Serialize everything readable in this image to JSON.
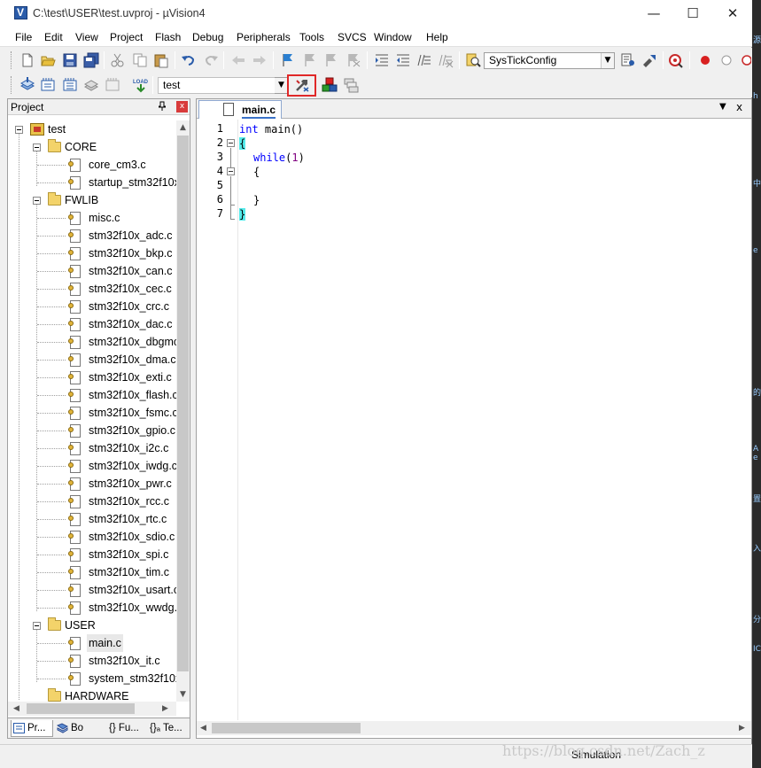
{
  "window": {
    "title": "C:\\test\\USER\\test.uvproj - µVision4",
    "minimize": "—",
    "maximize": "☐",
    "close": "✕"
  },
  "menu": [
    "File",
    "Edit",
    "View",
    "Project",
    "Flash",
    "Debug",
    "Peripherals",
    "Tools",
    "SVCS",
    "Window",
    "Help"
  ],
  "toolbar1": {
    "find_combo_value": "SysTickConfig"
  },
  "toolbar2": {
    "target_combo_value": "test",
    "load_label": "LOAD"
  },
  "project_panel": {
    "title": "Project",
    "pin": "📌",
    "close": "x",
    "root": "test",
    "groups": {
      "core": "CORE",
      "fwlib": "FWLIB",
      "user": "USER",
      "hardware": "HARDWARE"
    },
    "core_files": [
      "core_cm3.c",
      "startup_stm32f10x"
    ],
    "fwlib_files": [
      "misc.c",
      "stm32f10x_adc.c",
      "stm32f10x_bkp.c",
      "stm32f10x_can.c",
      "stm32f10x_cec.c",
      "stm32f10x_crc.c",
      "stm32f10x_dac.c",
      "stm32f10x_dbgmc",
      "stm32f10x_dma.c",
      "stm32f10x_exti.c",
      "stm32f10x_flash.c",
      "stm32f10x_fsmc.c",
      "stm32f10x_gpio.c",
      "stm32f10x_i2c.c",
      "stm32f10x_iwdg.c",
      "stm32f10x_pwr.c",
      "stm32f10x_rcc.c",
      "stm32f10x_rtc.c",
      "stm32f10x_sdio.c",
      "stm32f10x_spi.c",
      "stm32f10x_tim.c",
      "stm32f10x_usart.c",
      "stm32f10x_wwdg."
    ],
    "user_files": [
      "main.c",
      "stm32f10x_it.c",
      "system_stm32f10x"
    ],
    "tabs": [
      "Pr...",
      "Bo",
      "{} Fu...",
      "{}ₐ Te..."
    ]
  },
  "editor": {
    "tab_label": "main.c",
    "tab_menu": "▼",
    "tab_close": "x",
    "line_numbers": [
      "1",
      "2",
      "3",
      "4",
      "5",
      "6",
      "7"
    ],
    "code": {
      "l1_kw": "int",
      "l1_rest": " main()",
      "l2": "{",
      "l3_kw": "while",
      "l3_open": "(",
      "l3_num": "1",
      "l3_close": ")",
      "l4": "{",
      "l6": "}",
      "l7": "}"
    }
  },
  "status": {
    "mode": "Simulation"
  },
  "watermark": "https://blog.csdn.net/Zach_z",
  "colors": {
    "annotation_red": "#e02828",
    "keyword_blue": "#0000ff",
    "brace_highlight": "#54ebeb"
  },
  "edge_marks": [
    "源",
    "h",
    "中",
    "e",
    "的",
    "A",
    "е",
    "置",
    "入",
    "分",
    "IC"
  ]
}
